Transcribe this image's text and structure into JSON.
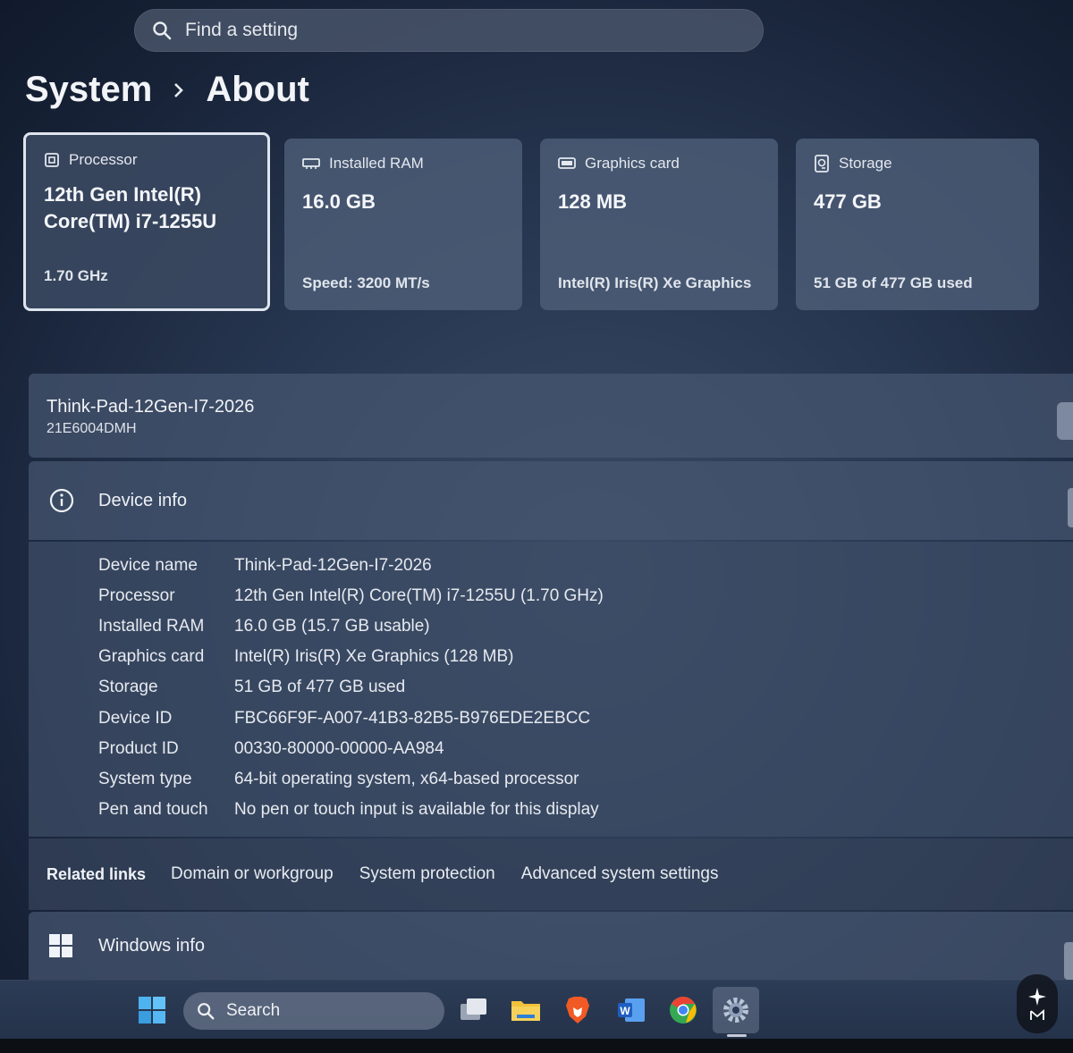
{
  "search": {
    "placeholder": "Find a setting"
  },
  "breadcrumb": {
    "parent": "System",
    "current": "About"
  },
  "cards": [
    {
      "title": "Processor",
      "value": "12th Gen Intel(R) Core(TM) i7-1255U",
      "sub": "1.70 GHz",
      "icon": "processor-icon"
    },
    {
      "title": "Installed RAM",
      "value": "16.0 GB",
      "sub": "Speed: 3200 MT/s",
      "icon": "ram-icon"
    },
    {
      "title": "Graphics card",
      "value": "128 MB",
      "sub": "Intel(R) Iris(R) Xe Graphics",
      "icon": "graphics-card-icon"
    },
    {
      "title": "Storage",
      "value": "477 GB",
      "sub": "51 GB of 477 GB used",
      "icon": "storage-icon"
    }
  ],
  "pc": {
    "name": "Think-Pad-12Gen-I7-2026",
    "model": "21E6004DMH"
  },
  "device_info": {
    "title": "Device info",
    "specs": [
      {
        "label": "Device name",
        "value": "Think-Pad-12Gen-I7-2026"
      },
      {
        "label": "Processor",
        "value": "12th Gen Intel(R) Core(TM) i7-1255U (1.70 GHz)"
      },
      {
        "label": "Installed RAM",
        "value": "16.0 GB (15.7 GB usable)"
      },
      {
        "label": "Graphics card",
        "value": "Intel(R) Iris(R) Xe Graphics (128 MB)"
      },
      {
        "label": "Storage",
        "value": "51 GB of 477 GB used"
      },
      {
        "label": "Device ID",
        "value": "FBC66F9F-A007-41B3-82B5-B976EDE2EBCC"
      },
      {
        "label": "Product ID",
        "value": "00330-80000-00000-AA984"
      },
      {
        "label": "System type",
        "value": "64-bit operating system, x64-based processor"
      },
      {
        "label": "Pen and touch",
        "value": "No pen or touch input is available for this display"
      }
    ]
  },
  "related_links": {
    "title": "Related links",
    "links": [
      "Domain or workgroup",
      "System protection",
      "Advanced system settings"
    ]
  },
  "windows_info": {
    "title": "Windows info"
  },
  "taskbar": {
    "search_label": "Search",
    "apps": [
      "start-icon",
      "task-view-icon",
      "file-explorer-icon",
      "brave-browser-icon",
      "word-icon",
      "chrome-icon",
      "settings-icon"
    ]
  },
  "colors": {
    "background": "#273650",
    "card": "#4e5e78",
    "accent_selected_border": "#dfe5ee"
  }
}
